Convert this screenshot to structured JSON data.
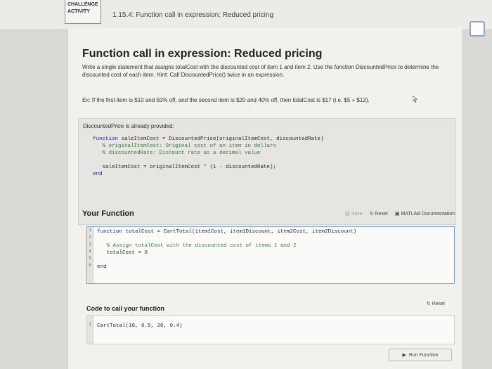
{
  "header": {
    "activity_label_line1": "CHALLENGE",
    "activity_label_line2": "ACTIVITY",
    "activity_title": "1.15.4: Function call in expression: Reduced pricing"
  },
  "content": {
    "title": "Function call in expression: Reduced pricing",
    "instructions": "Write a single statement that assigns totalCost with the discounted cost of item 1 and item 2. Use the function DiscountedPrice to determine the discounted cost of each item. Hint: Call DiscountedPrice() twice in an expression.",
    "example": "Ex: If the first item is $10 and 50% off, and the second item is $20 and 40% off, then totalCost is $17 (i.e. $5 + $12).",
    "provided_label": "DiscountedPrice is already provided:",
    "provided_code": [
      {
        "k": "function",
        "t": " saleItemCost = DiscountedPrice(originalItemCost, discountedRate)"
      },
      {
        "c": "   % originalItemCost: Original cost of an item in dollars"
      },
      {
        "c": "   % discountedRate: Discount rate as a decimal value"
      },
      {
        "t": ""
      },
      {
        "t": "   saleItemCost = originalItemCost * (1 - discountedRate);"
      },
      {
        "k": "end",
        "t": ""
      }
    ]
  },
  "your_function": {
    "title": "Your Function",
    "save_label": "Save",
    "reset_label": "Reset",
    "matlab_docs_label": "MATLAB Documentation",
    "lines": [
      {
        "n": "1",
        "k": "function",
        "t": " totalCost = CartTotal(item1Cost, item1Discount, item2Cost, item2Discount)"
      },
      {
        "n": "2",
        "t": ""
      },
      {
        "n": "3",
        "c": "   % Assign totalCost with the discounted cost of items 1 and 2"
      },
      {
        "n": "4",
        "t": "   totalCost = 0"
      },
      {
        "n": "5",
        "t": ""
      },
      {
        "n": "6",
        "k": "end",
        "t": ""
      }
    ]
  },
  "call_section": {
    "title": "Code to call your function",
    "reset_label": "Reset",
    "line_number": "1",
    "code": "CartTotal(10, 0.5, 20, 0.4)",
    "run_label": "Run Function"
  }
}
